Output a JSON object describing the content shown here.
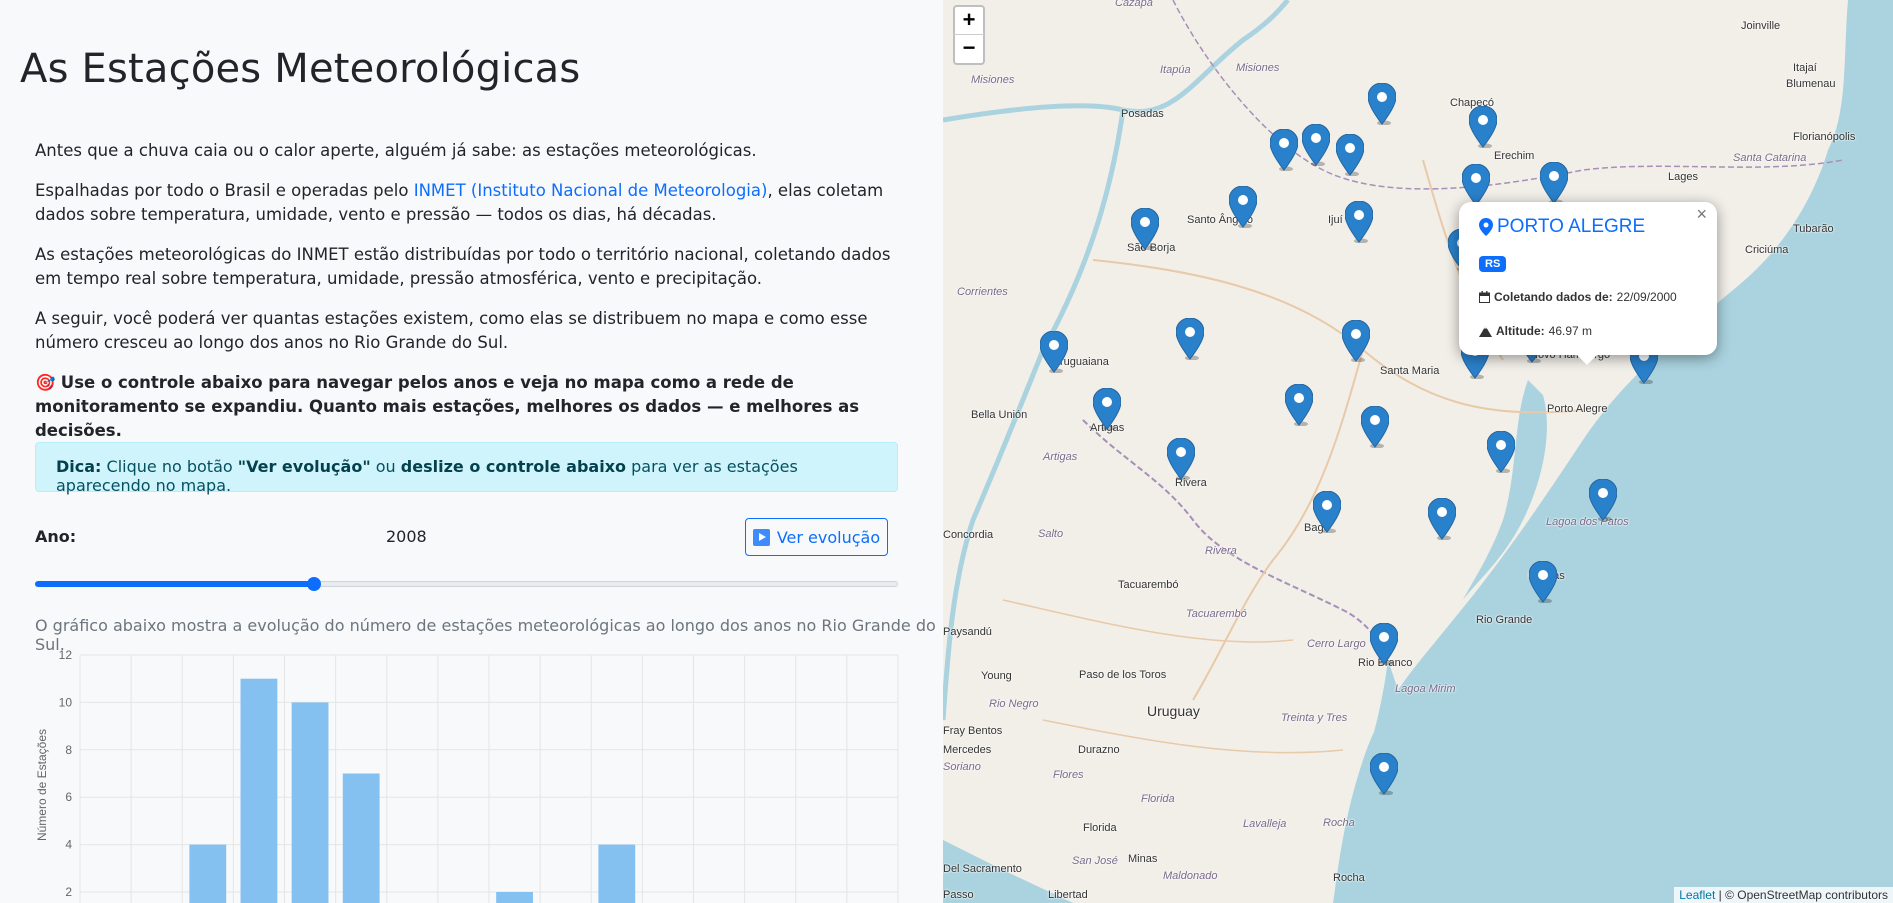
{
  "page": {
    "title": "As Estações Meteorológicas",
    "intro_1": "Antes que a chuva caia ou o calor aperte, alguém já sabe: as estações meteorológicas.",
    "intro_2a": "Espalhadas por todo o Brasil e operadas pelo ",
    "intro_2_link": "INMET (Instituto Nacional de Meteorologia)",
    "intro_2b": ", elas coletam dados sobre temperatura, umidade, vento e pressão — todos os dias, há décadas.",
    "intro_3": "As estações meteorológicas do INMET estão distribuídas por todo o território nacional, coletando dados em tempo real sobre temperatura, umidade, pressão atmosférica, vento e precipitação.",
    "intro_4": "A seguir, você poderá ver quantas estações existem, como elas se distribuem no mapa e como esse número cresceu ao longo dos anos no Rio Grande do Sul.",
    "intro_5_emoji": "🎯",
    "intro_5": "Use o controle abaixo para navegar pelos anos e veja no mapa como a rede de monitoramento se expandiu. Quanto mais estações, melhores os dados — e melhores as decisões."
  },
  "tip": {
    "label": "Dica:",
    "text_1": " Clique no botão ",
    "button_ref": "\"Ver evolução\"",
    "text_2": " ou ",
    "slider_ref": "deslize o controle abaixo",
    "text_3": " para ver as estações aparecendo no mapa."
  },
  "controls": {
    "year_label": "Ano:",
    "year_value": "2008",
    "evolution_button": "Ver evolução",
    "slider_fraction": 0.323
  },
  "chart_caption": "O gráfico abaixo mostra a evolução do número de estações meteorológicas ao longo dos anos no Rio Grande do Sul.",
  "chart_data": {
    "type": "bar",
    "ylabel": "Número de Estações",
    "ylim": [
      0,
      12
    ],
    "yticks": [
      2,
      4,
      6,
      8,
      10,
      12
    ],
    "values": [
      0,
      4,
      11,
      10,
      7,
      0,
      0,
      2,
      0,
      4,
      0,
      0,
      0
    ],
    "grid": true,
    "colors": {
      "bar": "#85c1f0",
      "grid": "#e5e5e5"
    }
  },
  "map": {
    "zoom_in": "+",
    "zoom_out": "−",
    "attribution_link": "Leaflet",
    "attribution_text": " | © OpenStreetMap contributors",
    "popup": {
      "close": "×",
      "station": "PORTO ALEGRE",
      "badge": "RS",
      "date_label": "Coletando dados de:",
      "date_value": "22/09/2000",
      "altitude_label": "Altitude:",
      "altitude_value": "46.97 m"
    },
    "places": [
      "Cazapá",
      "Joinville",
      "Misiones",
      "Itapúa",
      "Misiones",
      "Posadas",
      "Chapecó",
      "Itajaí",
      "Blumenau",
      "Florianópolis",
      "Santa Catarina",
      "Erechim",
      "Lages",
      "Tubarão",
      "Criciúma",
      "Santo Ângelo",
      "Ijuí",
      "São Borja",
      "Corrientes",
      "Uruguaiana",
      "Santa Maria",
      "Novo Hamburgo",
      "Porto Alegre",
      "Bella Unión",
      "Artigas",
      "Artigas",
      "Rivera",
      "Concordia",
      "Salto",
      "Bagé",
      "Rivera",
      "Pelotas",
      "Tacuarembó",
      "Rio Grande",
      "Lagoa dos Patos",
      "Paysandú",
      "Tacuarembó",
      "Cerro Largo",
      "Rio Branco",
      "Young",
      "Paso de los Toros",
      "Rio Negro",
      "Uruguay",
      "Lagoa Mirim",
      "Fray Bentos",
      "Treinta y Tres",
      "Mercedes",
      "Durazno",
      "Soriano",
      "Flores",
      "Florida",
      "Florida",
      "Lavalleja",
      "Rocha",
      "Del Sacramento",
      "San José",
      "Minas",
      "Maldonado",
      "Rocha",
      "Libertad",
      "Passo"
    ]
  }
}
